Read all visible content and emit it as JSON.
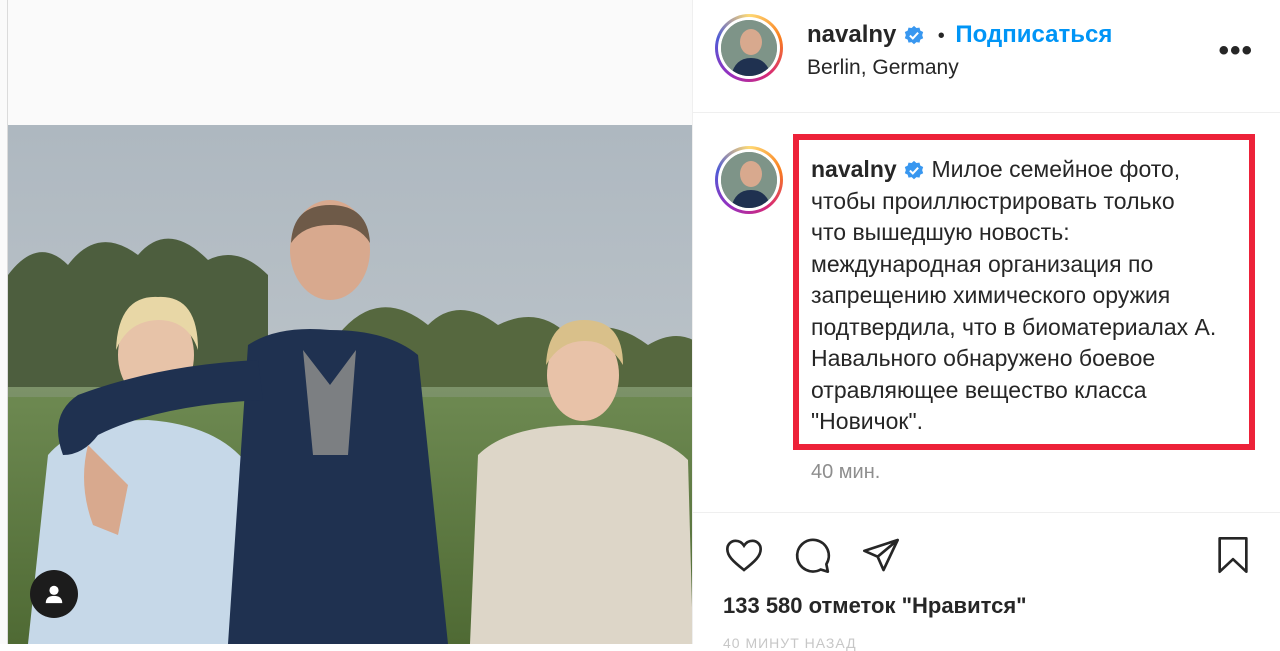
{
  "post": {
    "username": "navalny",
    "verified": true,
    "follow_label": "Подписаться",
    "separator": "•",
    "location": "Berlin, Germany",
    "more_label": "•••",
    "caption_author": "navalny",
    "caption_lines": [
      "Милое семейное фото,",
      "чтобы проиллюстрировать только",
      "что вышедшую новость:",
      "международная организация по",
      "запрещению химического оружия",
      "подтвердила, что в биоматериалах А.",
      "Навального обнаружено боевое",
      "отравляющее вещество класса",
      "\"Новичок\"."
    ],
    "caption_time": "40 мин.",
    "likes": "133 580 отметок \"Нравится\"",
    "posted_ago": "40 минут назад"
  },
  "icons": {
    "like": "heart-icon",
    "comment": "comment-icon",
    "share": "paper-plane-icon",
    "save": "bookmark-icon",
    "user_tag": "person-icon",
    "verified": "verified-badge-icon",
    "more": "more-options-icon"
  },
  "colors": {
    "follow": "#0095f6",
    "highlight_box": "#ed2239",
    "verified": "#3897f0",
    "muted": "#8e8e8e"
  }
}
